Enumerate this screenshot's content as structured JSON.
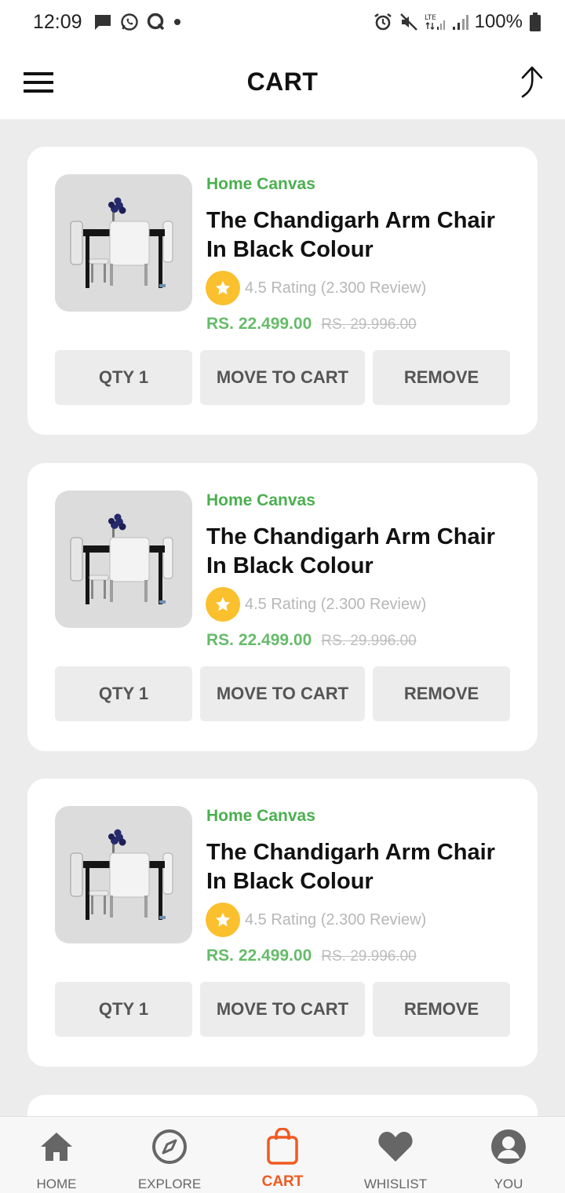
{
  "status_bar": {
    "time": "12:09",
    "battery": "100%"
  },
  "header": {
    "title": "CART"
  },
  "cart_items": [
    {
      "brand": "Home Canvas",
      "title": "The Chandigarh Arm Chair In Black Colour",
      "rating": "4.5 Rating (2.300 Review)",
      "price": "RS. 22.499.00",
      "old_price": "RS. 29.996.00",
      "qty_label": "QTY 1",
      "move_label": "MOVE TO CART",
      "remove_label": "REMOVE"
    },
    {
      "brand": "Home Canvas",
      "title": "The Chandigarh Arm Chair In Black Colour",
      "rating": "4.5 Rating (2.300 Review)",
      "price": "RS. 22.499.00",
      "old_price": "RS. 29.996.00",
      "qty_label": "QTY 1",
      "move_label": "MOVE TO CART",
      "remove_label": "REMOVE"
    },
    {
      "brand": "Home Canvas",
      "title": "The Chandigarh Arm Chair In Black Colour",
      "rating": "4.5 Rating (2.300 Review)",
      "price": "RS. 22.499.00",
      "old_price": "RS. 29.996.00",
      "qty_label": "QTY 1",
      "move_label": "MOVE TO CART",
      "remove_label": "REMOVE"
    }
  ],
  "bottom_nav": [
    {
      "label": "HOME",
      "icon": "home-icon"
    },
    {
      "label": "EXPLORE",
      "icon": "compass-icon"
    },
    {
      "label": "CART",
      "icon": "shopping-bag-icon",
      "active": true
    },
    {
      "label": "WHISLIST",
      "icon": "heart-icon"
    },
    {
      "label": "YOU",
      "icon": "user-icon"
    }
  ],
  "colors": {
    "brand_green": "#4caf50",
    "price_green": "#66bb6a",
    "star": "#fbc02d",
    "active_nav": "#f05a22",
    "background": "#ececec"
  }
}
